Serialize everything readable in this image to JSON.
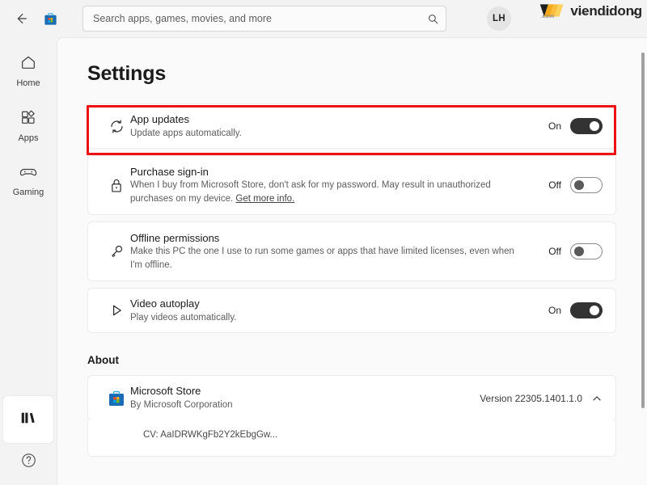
{
  "titlebar": {
    "back_icon": "back-arrow-icon",
    "app_icon": "microsoft-store-icon",
    "search": {
      "placeholder": "Search apps, games, movies, and more",
      "value": "",
      "icon": "search-icon"
    },
    "account": {
      "initials": "LH",
      "name": "avatar"
    },
    "window_controls": {
      "minimize": "—",
      "maximize": "□",
      "close": "✕"
    },
    "watermark": {
      "text": "viendidong",
      "subtext": ".com"
    }
  },
  "sidebar": {
    "items": [
      {
        "label": "Home",
        "icon": "home-icon",
        "selected": false
      },
      {
        "label": "Apps",
        "icon": "apps-icon",
        "selected": false
      },
      {
        "label": "Gaming",
        "icon": "gaming-controller-icon",
        "selected": false
      }
    ],
    "bottom": [
      {
        "label": "Library",
        "icon": "library-books-icon",
        "selected": true
      },
      {
        "label": "Help",
        "icon": "help-question-icon",
        "selected": false
      }
    ]
  },
  "main": {
    "page_title": "Settings",
    "settings": [
      {
        "title": "App updates",
        "desc": "Update apps automatically.",
        "icon": "sync-refresh-icon",
        "state_label": "On",
        "state": "on",
        "highlighted": true
      },
      {
        "title": "Purchase sign-in",
        "desc": "When I buy from Microsoft Store, don't ask for my password. May result in unauthorized purchases on my device. ",
        "link": "Get more info.",
        "icon": "lock-icon",
        "state_label": "Off",
        "state": "off",
        "highlighted": false
      },
      {
        "title": "Offline permissions",
        "desc": "Make this PC the one I use to run some games or apps that have limited licenses, even when I'm offline.",
        "icon": "key-icon",
        "state_label": "Off",
        "state": "off",
        "highlighted": false
      },
      {
        "title": "Video autoplay",
        "desc": "Play videos automatically.",
        "icon": "play-triangle-icon",
        "state_label": "On",
        "state": "on",
        "highlighted": false
      }
    ],
    "about": {
      "heading": "About",
      "app_name": "Microsoft Store",
      "publisher": "By Microsoft Corporation",
      "version": "Version 22305.1401.1.0",
      "expander_icon": "chevron-up-icon",
      "cv_text": "CV: AaIDRWKgFb2Y2kEbgGw..."
    }
  },
  "colors": {
    "highlight": "#ee1111",
    "toggle_on": "#333333",
    "window_bg": "#f3f3f3",
    "content_bg": "#fafafa"
  }
}
